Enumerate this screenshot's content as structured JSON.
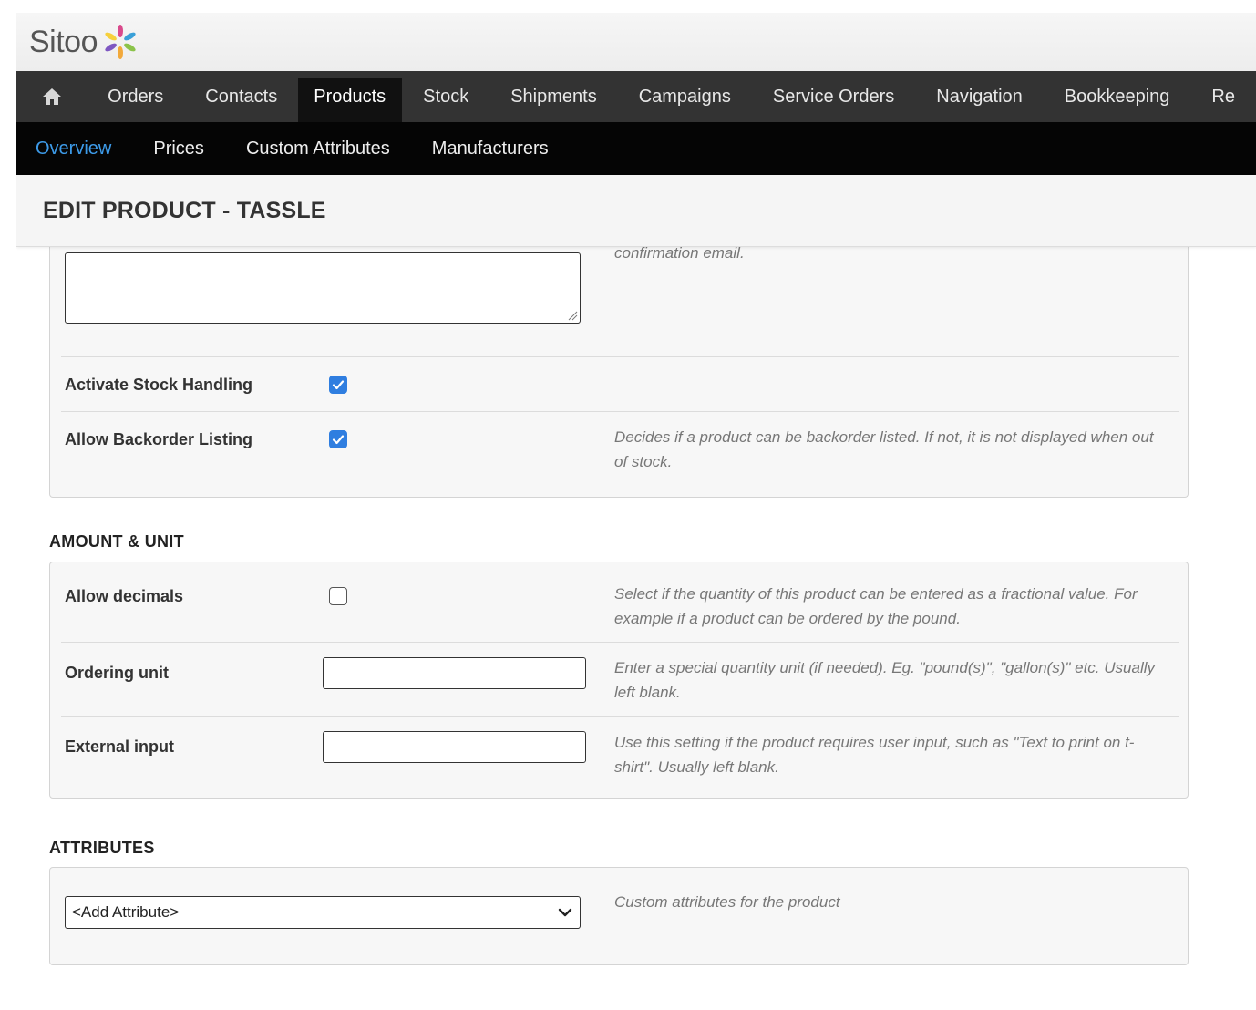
{
  "brand": {
    "name": "Sitoo",
    "logo_mark": "flower-logo-icon"
  },
  "main_nav": {
    "home_icon": "home-icon",
    "items": [
      {
        "label": "Orders"
      },
      {
        "label": "Contacts"
      },
      {
        "label": "Products",
        "active": true
      },
      {
        "label": "Stock"
      },
      {
        "label": "Shipments"
      },
      {
        "label": "Campaigns"
      },
      {
        "label": "Service Orders"
      },
      {
        "label": "Navigation"
      },
      {
        "label": "Bookkeeping"
      },
      {
        "label": "Re"
      }
    ]
  },
  "sub_nav": {
    "items": [
      {
        "label": "Overview",
        "active": true
      },
      {
        "label": "Prices"
      },
      {
        "label": "Custom Attributes"
      },
      {
        "label": "Manufacturers"
      }
    ]
  },
  "page": {
    "title": "EDIT PRODUCT - TASSLE"
  },
  "stock_panel": {
    "partial_help": "confirmation email.",
    "notes_value": "",
    "rows": [
      {
        "label": "Activate Stock Handling",
        "checked": true,
        "help": ""
      },
      {
        "label": "Allow Backorder Listing",
        "checked": true,
        "help": "Decides if a product can be backorder listed. If not, it is not displayed when out of stock."
      }
    ]
  },
  "amount_unit": {
    "heading": "AMOUNT & UNIT",
    "allow_decimals": {
      "label": "Allow decimals",
      "checked": false,
      "help": "Select if the quantity of this product can be entered as a fractional value. For example if a product can be ordered by the pound."
    },
    "ordering_unit": {
      "label": "Ordering unit",
      "value": "",
      "help": "Enter a special quantity unit (if needed). Eg. \"pound(s)\", \"gallon(s)\" etc. Usually left blank."
    },
    "external_input": {
      "label": "External input",
      "value": "",
      "help": "Use this setting if the product requires user input, such as \"Text to print on t-shirt\". Usually left blank."
    }
  },
  "attributes": {
    "heading": "ATTRIBUTES",
    "select_value": "<Add Attribute>",
    "help": "Custom attributes for the product"
  },
  "colors": {
    "nav_bg": "#333333",
    "subnav_bg": "#050505",
    "active_tab_bg": "#111111",
    "accent": "#3d9be9",
    "checkbox_blue": "#2f7ee0",
    "help_text": "#777777"
  }
}
